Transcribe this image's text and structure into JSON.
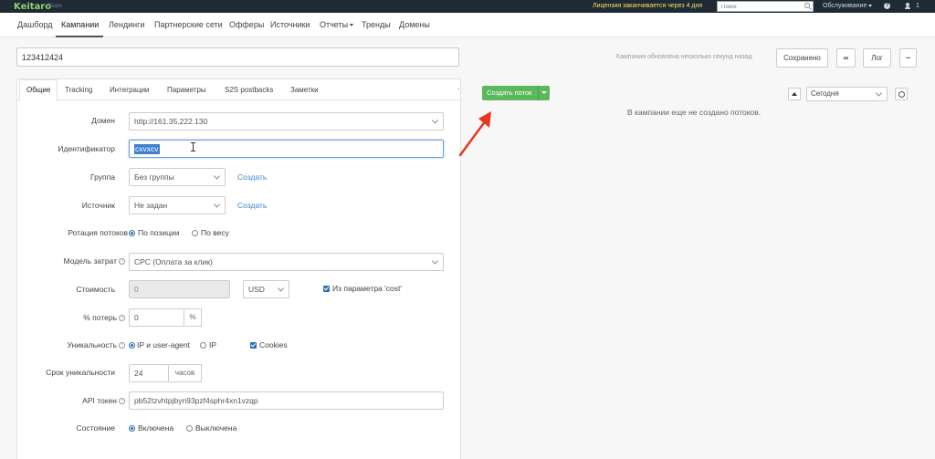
{
  "topbar": {
    "logo": "Keitaro",
    "logo_sub": "Team",
    "license_notice": "Лицензия заканчивается через 4 дня",
    "search_placeholder": "Поиск",
    "service_menu": "Обслуживание",
    "user_count": "1"
  },
  "nav": {
    "items": [
      "Дашборд",
      "Кампании",
      "Лендинги",
      "Партнерские сети",
      "Офферы",
      "Источники",
      "Отчеты",
      "Тренды",
      "Домены"
    ],
    "active": "Кампании"
  },
  "campaign": {
    "name": "123412424",
    "updated_notice": "Кампания обновлена несколько секунд назад",
    "saved_label": "Сохранено",
    "link_icon_label": "∞",
    "log_label": "Лог",
    "more_label": "···"
  },
  "tabs": [
    "Общие",
    "Tracking",
    "Интеграции",
    "Параметры",
    "S2S postbacks",
    "Заметки"
  ],
  "form": {
    "domain": {
      "label": "Домен",
      "value": "http://161.35.222.130"
    },
    "identifier": {
      "label": "Идентификатор",
      "value": "cxvxcv"
    },
    "group": {
      "label": "Группа",
      "value": "Без группы",
      "link": "Создать"
    },
    "source": {
      "label": "Источник",
      "value": "Не задан",
      "link": "Создать"
    },
    "rotation": {
      "label": "Ротация потоков",
      "options": [
        "По позиции",
        "По весу"
      ],
      "selected": "По позиции"
    },
    "cost_model": {
      "label": "Модель затрат",
      "value": "CPC (Оплата за клик)"
    },
    "cost": {
      "label": "Стоимость",
      "value": "0",
      "currency": "USD",
      "from_param": "Из параметра 'cost'"
    },
    "loss": {
      "label": "% потерь",
      "value": "0",
      "unit": "%"
    },
    "uniqueness": {
      "label": "Уникальность",
      "options": [
        "IP и user-agent",
        "IP"
      ],
      "selected": "IP и user-agent",
      "cookies": "Cookies"
    },
    "uniq_term": {
      "label": "Срок уникальности",
      "value": "24",
      "unit": "часов"
    },
    "api_token": {
      "label": "API токен",
      "value": "pb52tzvhtpjbyn93pzf4sphr4xn1vzqp"
    },
    "state": {
      "label": "Состояние",
      "options": [
        "Включена",
        "Выключена"
      ],
      "selected": "Включена"
    }
  },
  "streams": {
    "create_label": "Создать поток",
    "empty_message": "В кампании еще не создано потоков.",
    "period": "Сегодня"
  },
  "colors": {
    "topbar": "#1f2a35",
    "accent_green": "#5cb85c",
    "link_blue": "#3d86c6",
    "annotation_arrow": "#e8351f"
  }
}
